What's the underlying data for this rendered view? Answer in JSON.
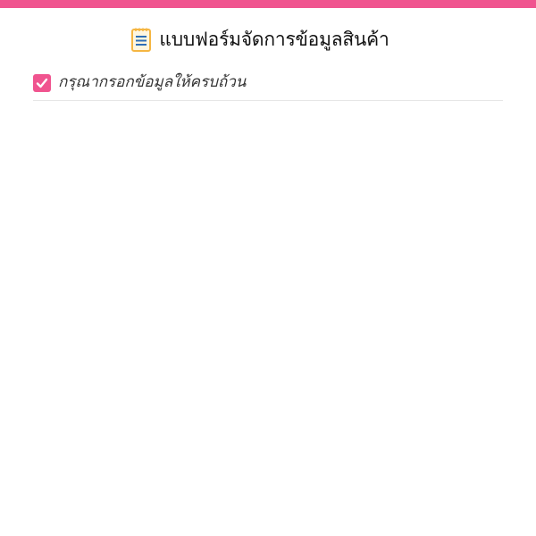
{
  "header": {
    "icon": "notepad-icon",
    "title": "แบบฟอร์มจัดการข้อมูลสินค้า"
  },
  "notice": {
    "icon": "check-icon",
    "text": "กรุณากรอกข้อมูลให้ครบถ้วน"
  },
  "colors": {
    "accent": "#f0548f",
    "notepad_blue": "#2f6fb6",
    "notepad_yellow": "#f5b642"
  }
}
